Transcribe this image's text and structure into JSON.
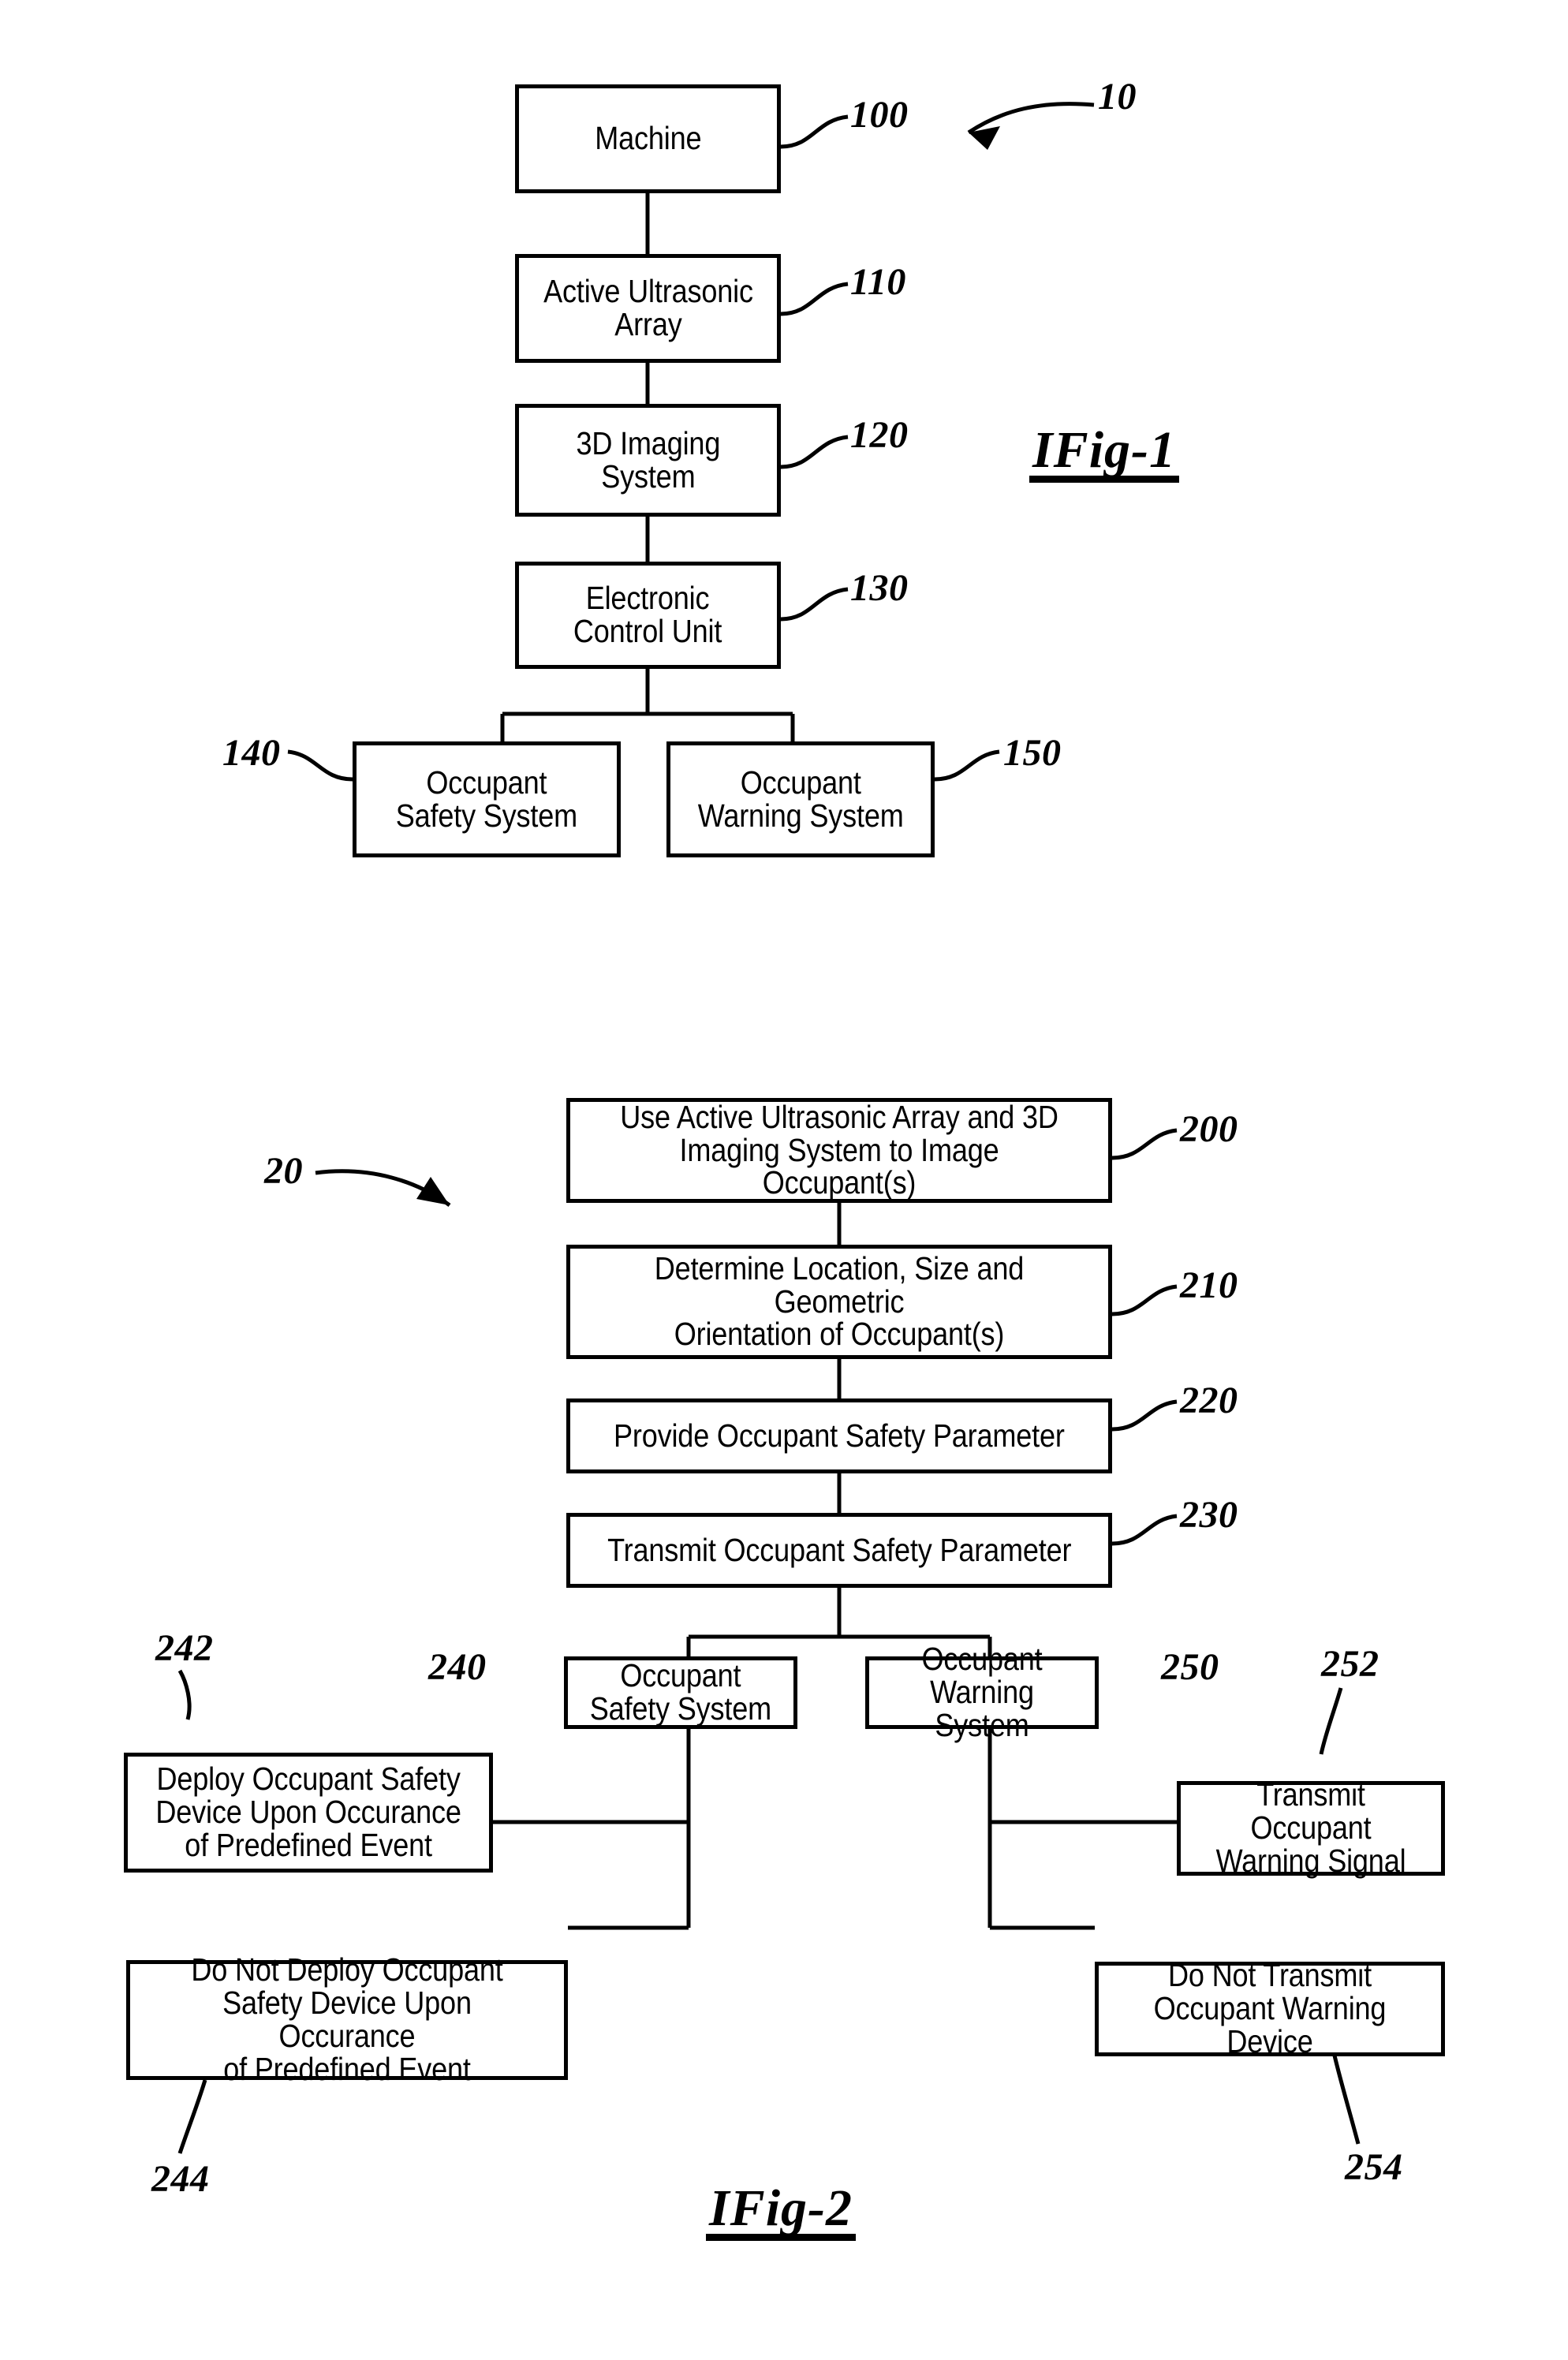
{
  "document": {
    "type": "patent-drawing-sheet",
    "figures": [
      "Fig-1",
      "Fig-2"
    ]
  },
  "figure1": {
    "caption": "IFig-1",
    "system_ref": "10",
    "boxes": [
      {
        "id": "machine",
        "label": "Machine",
        "ref": "100"
      },
      {
        "id": "active-ultrasonic-array",
        "label": "Active Ultrasonic\nArray",
        "ref": "110"
      },
      {
        "id": "3d-imaging-system",
        "label": "3D Imaging\nSystem",
        "ref": "120"
      },
      {
        "id": "electronic-control-unit",
        "label": "Electronic\nControl Unit",
        "ref": "130"
      },
      {
        "id": "occupant-safety-system",
        "label": "Occupant\nSafety System",
        "ref": "140"
      },
      {
        "id": "occupant-warning-system",
        "label": "Occupant\nWarning System",
        "ref": "150"
      }
    ]
  },
  "figure2": {
    "caption": "IFig-2",
    "method_ref": "20",
    "boxes": [
      {
        "id": "step-image-occupants",
        "label": "Use Active Ultrasonic Array and 3D\nImaging System to Image Occupant(s)",
        "ref": "200"
      },
      {
        "id": "step-determine-location",
        "label": "Determine Location, Size and Geometric\nOrientation of Occupant(s)",
        "ref": "210"
      },
      {
        "id": "step-provide-parameter",
        "label": "Provide Occupant Safety Parameter",
        "ref": "220"
      },
      {
        "id": "step-transmit-parameter",
        "label": "Transmit Occupant Safety Parameter",
        "ref": "230"
      },
      {
        "id": "occupant-safety-system",
        "label": "Occupant\nSafety System",
        "ref": "240"
      },
      {
        "id": "occupant-warning-system",
        "label": "Occupant\nWarning System",
        "ref": "250"
      },
      {
        "id": "deploy-safety-device",
        "label": "Deploy Occupant Safety\nDevice Upon Occurance\nof Predefined Event",
        "ref": "242"
      },
      {
        "id": "do-not-deploy-safety-device",
        "label": "Do Not Deploy Occupant\nSafety Device Upon Occurance\nof Predefined Event",
        "ref": "244"
      },
      {
        "id": "transmit-warning-signal",
        "label": "Transmit Occupant\nWarning Signal",
        "ref": "252"
      },
      {
        "id": "do-not-transmit-warning",
        "label": "Do Not Transmit\nOccupant Warning Device",
        "ref": "254"
      }
    ]
  },
  "colors": {
    "ink": "#000000",
    "paper": "#ffffff"
  }
}
